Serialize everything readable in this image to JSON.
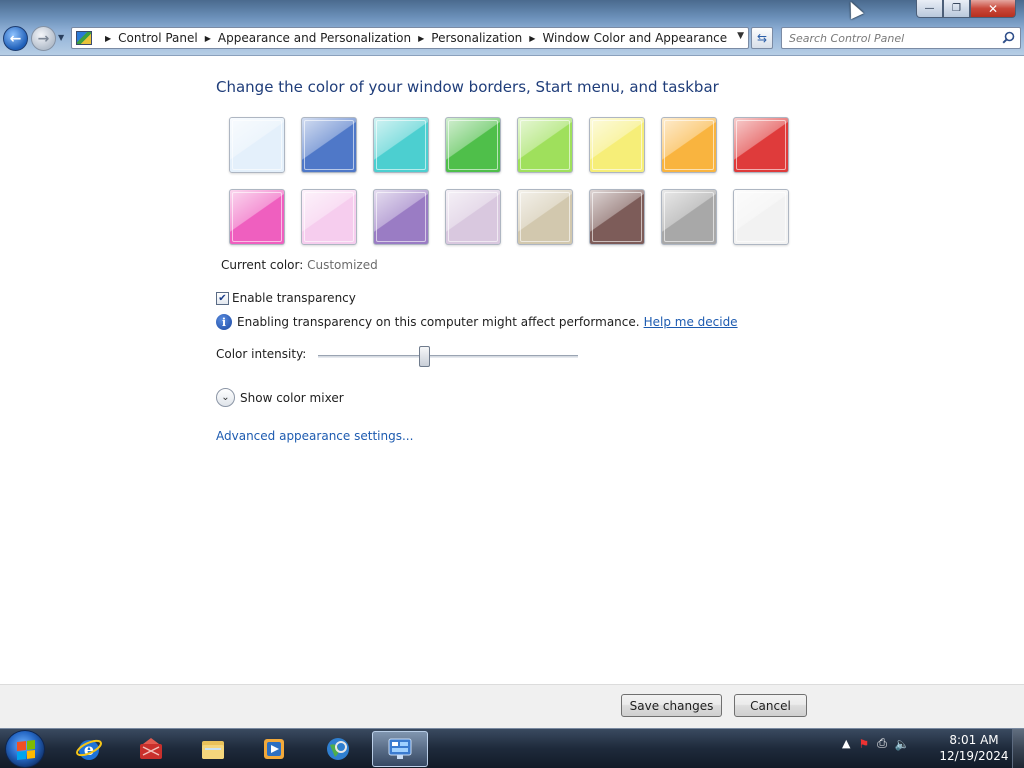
{
  "nav": {
    "breadcrumbs": [
      "Control Panel",
      "Appearance and Personalization",
      "Personalization",
      "Window Color and Appearance"
    ],
    "search_placeholder": "Search Control Panel"
  },
  "main": {
    "heading": "Change the color of your window borders, Start menu, and taskbar",
    "swatches": [
      {
        "name": "sky",
        "color": "#e4f0fb"
      },
      {
        "name": "twilight",
        "color": "#4f78c8"
      },
      {
        "name": "sea",
        "color": "#4ccfd0"
      },
      {
        "name": "leaf",
        "color": "#4fbf4a"
      },
      {
        "name": "lime",
        "color": "#9fe05c"
      },
      {
        "name": "lemon",
        "color": "#f6ee78"
      },
      {
        "name": "pumpkin",
        "color": "#f9b43f"
      },
      {
        "name": "ruby",
        "color": "#df3b3b"
      },
      {
        "name": "fuchsia",
        "color": "#ef5fbf"
      },
      {
        "name": "blush",
        "color": "#f6cdee"
      },
      {
        "name": "violet",
        "color": "#9a7cc4"
      },
      {
        "name": "lavender",
        "color": "#d9c8df"
      },
      {
        "name": "taupe",
        "color": "#d2c8ae"
      },
      {
        "name": "chocolate",
        "color": "#7d5c59"
      },
      {
        "name": "slate",
        "color": "#a8a8a8"
      },
      {
        "name": "frost",
        "color": "#f2f2f2"
      }
    ],
    "current_color_label": "Current color:",
    "current_color_value": "Customized",
    "enable_transparency_label": "Enable transparency",
    "enable_transparency_checked": true,
    "perf_note": "Enabling transparency on this computer might affect performance.",
    "help_link": "Help me decide",
    "intensity_label": "Color intensity:",
    "intensity_fraction": 0.41,
    "mixer_label": "Show color mixer",
    "advanced_link": "Advanced appearance settings..."
  },
  "buttons": {
    "save": "Save changes",
    "cancel": "Cancel"
  },
  "taskbar": {
    "time": "8:01 AM",
    "date": "12/19/2024",
    "apps": [
      "internet-explorer",
      "toolbox",
      "file-explorer",
      "media-player",
      "globe-app",
      "control-panel"
    ]
  },
  "colors": {
    "heading": "#1f3d7a",
    "link": "#1d5bb0"
  }
}
